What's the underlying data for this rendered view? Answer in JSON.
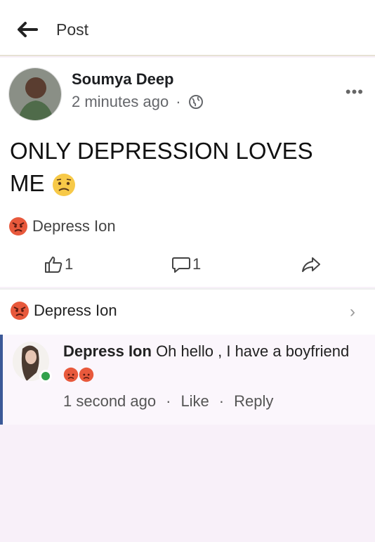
{
  "header": {
    "title": "Post"
  },
  "post": {
    "author": "Soumya Deep",
    "time": "2 minutes ago",
    "dot": "·",
    "more": "•••",
    "text": "ONLY DEPRESSION LOVES ME",
    "reaction_name": "Depress Ion",
    "likes": "1",
    "comments": "1"
  },
  "comments": {
    "header_name": "Depress Ion",
    "chevron": "›",
    "reply": {
      "author": "Depress Ion",
      "text": "Oh hello , I have a boyfriend",
      "time": "1 second ago",
      "dot": "·",
      "like": "Like",
      "reply": "Reply"
    }
  }
}
